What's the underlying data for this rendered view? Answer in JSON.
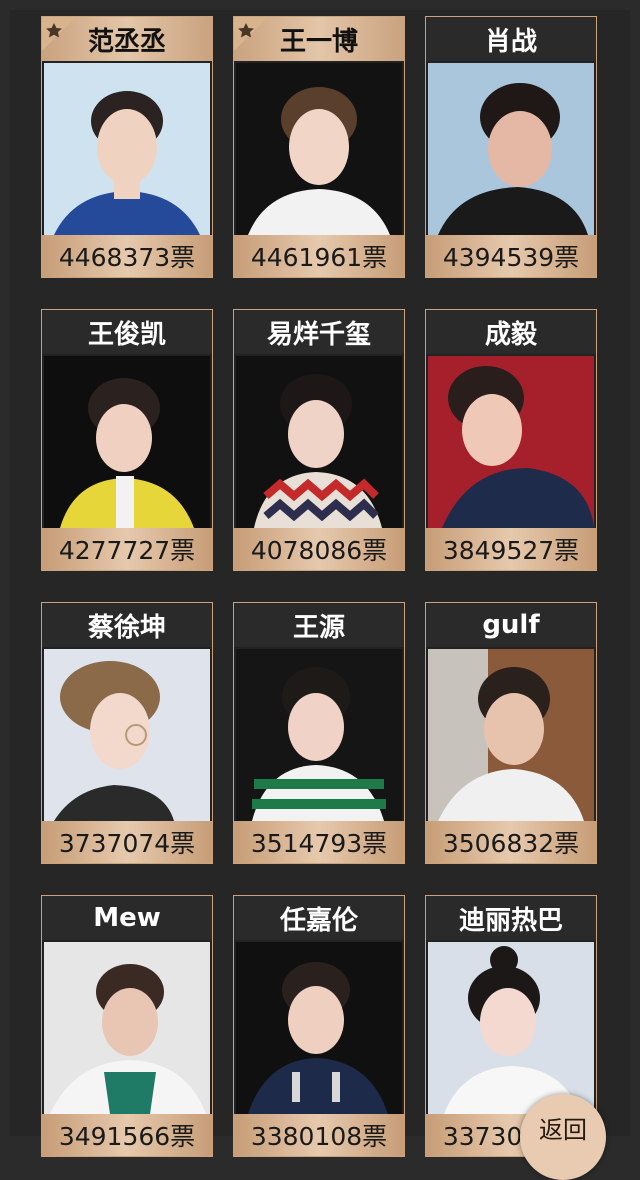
{
  "ranking": [
    {
      "name": "范丞丞",
      "votes": "4468373票",
      "highlight": true,
      "star": true,
      "bg": "#cfe2f0"
    },
    {
      "name": "王一博",
      "votes": "4461961票",
      "highlight": true,
      "star": true,
      "bg": "#121212"
    },
    {
      "name": "肖战",
      "votes": "4394539票",
      "highlight": false,
      "star": false,
      "bg": "#aac6dc"
    },
    {
      "name": "王俊凯",
      "votes": "4277727票",
      "highlight": false,
      "star": false,
      "bg": "#0e0e0e"
    },
    {
      "name": "易烊千玺",
      "votes": "4078086票",
      "highlight": false,
      "star": false,
      "bg": "#111111"
    },
    {
      "name": "成毅",
      "votes": "3849527票",
      "highlight": false,
      "star": false,
      "bg": "#a5202b"
    },
    {
      "name": "蔡徐坤",
      "votes": "3737074票",
      "highlight": false,
      "star": false,
      "bg": "#dfe3ec"
    },
    {
      "name": "王源",
      "votes": "3514793票",
      "highlight": false,
      "star": false,
      "bg": "#151515"
    },
    {
      "name": "gulf",
      "votes": "3506832票",
      "highlight": false,
      "star": false,
      "bg": "#8b5a3b"
    },
    {
      "name": "Mew",
      "votes": "3491566票",
      "highlight": false,
      "star": false,
      "bg": "#e6e6e6"
    },
    {
      "name": "任嘉伦",
      "votes": "3380108票",
      "highlight": false,
      "star": false,
      "bg": "#101010"
    },
    {
      "name": "迪丽热巴",
      "votes": "3373021票",
      "highlight": false,
      "star": false,
      "bg": "#d8dfe8"
    }
  ],
  "return_button": {
    "label": "返回"
  },
  "colors": {
    "gold": "#c9a37d",
    "background": "#262626"
  }
}
